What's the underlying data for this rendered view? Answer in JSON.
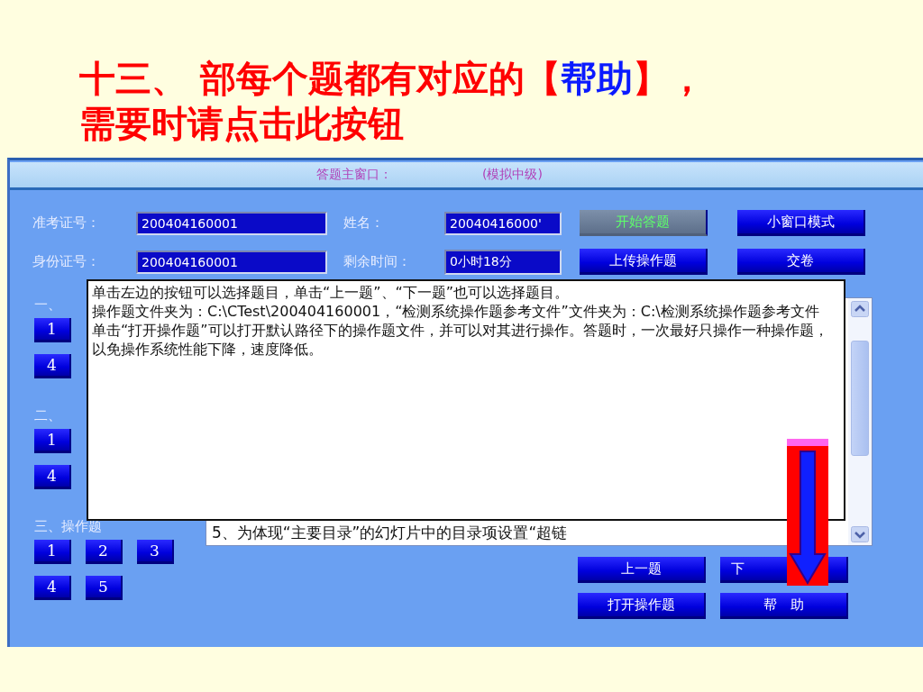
{
  "slide_title": {
    "lines": [
      [
        {
          "text": "十三、 部每个题都有对应的【",
          "kind": "plain"
        },
        {
          "text": "帮助",
          "kind": "highlight"
        },
        {
          "text": "】，",
          "kind": "plain"
        }
      ],
      [
        {
          "text": "需要时请点击此按钮",
          "kind": "plain"
        }
      ]
    ]
  },
  "window": {
    "title": "答题主窗口：",
    "subtitle": "(模拟中级)"
  },
  "header_rows": [
    {
      "fields": [
        {
          "label": "准考证号：",
          "value": "200404160001"
        },
        {
          "label": "姓名：",
          "value": "20040416000'"
        }
      ],
      "buttons": [
        {
          "label": "开始答题",
          "disabled": true
        },
        {
          "label": "小窗口模式",
          "disabled": false
        }
      ]
    },
    {
      "fields": [
        {
          "label": "身份证号：",
          "value": "200404160001"
        },
        {
          "label": "剩余时间：",
          "value": "0小时18分"
        }
      ],
      "buttons": [
        {
          "label": "上传操作题",
          "disabled": false
        },
        {
          "label": "交卷",
          "disabled": false
        }
      ]
    }
  ],
  "sections": [
    {
      "heading": "一、",
      "rows": [
        [
          "1"
        ],
        [
          "4"
        ]
      ]
    },
    {
      "heading": "二、",
      "rows": [
        [
          "1"
        ],
        [
          "4"
        ]
      ]
    },
    {
      "heading": "三、操作题",
      "rows": [
        [
          "1",
          "2",
          "3"
        ],
        [
          "4",
          "5"
        ]
      ]
    }
  ],
  "question_list": {
    "items": [
      "5、为体现“主要目录”的幻灯片中的目录项设置“超链"
    ]
  },
  "help_popup": {
    "paragraphs": [
      "单击左边的按钮可以选择题目，单击“上一题”、“下一题”也可以选择题目。",
      "操作题文件夹为：C:\\CTest\\200404160001，“检测系统操作题参考文件”文件夹为：C:\\检测系统操作题参考文件",
      "单击“打开操作题”可以打开默认路径下的操作题文件，并可以对其进行操作。答题时，一次最好只操作一种操作题，以免操作系统性能下降，速度降低。"
    ]
  },
  "nav_buttons": [
    {
      "label": "上一题"
    },
    {
      "label": "下"
    },
    {
      "label": "打开操作题"
    },
    {
      "label": "帮　助"
    }
  ]
}
